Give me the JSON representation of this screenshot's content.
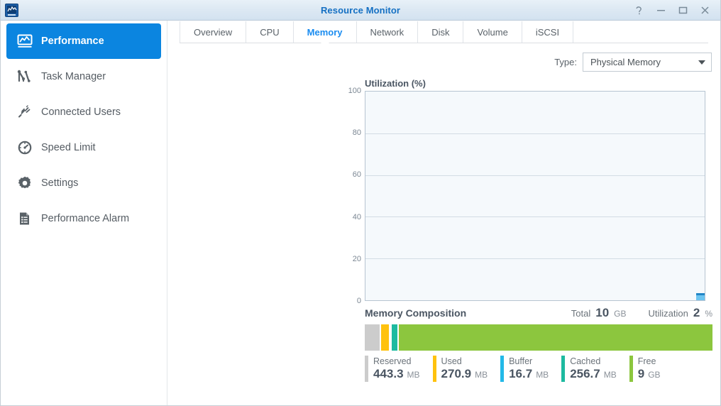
{
  "window": {
    "title": "Resource Monitor",
    "app_icon": "resource-monitor-icon",
    "buttons": [
      {
        "name": "help-button",
        "glyph": "?"
      },
      {
        "name": "minimize-button",
        "glyph": "–"
      },
      {
        "name": "maximize-button",
        "glyph": "☐"
      },
      {
        "name": "close-button",
        "glyph": "✕"
      }
    ]
  },
  "sidebar": {
    "items": [
      {
        "label": "Performance",
        "icon": "performance-chart-icon",
        "active": true
      },
      {
        "label": "Task Manager",
        "icon": "task-manager-icon",
        "active": false
      },
      {
        "label": "Connected Users",
        "icon": "plug-icon",
        "active": false
      },
      {
        "label": "Speed Limit",
        "icon": "speedometer-icon",
        "active": false
      },
      {
        "label": "Settings",
        "icon": "gear-icon",
        "active": false
      },
      {
        "label": "Performance Alarm",
        "icon": "document-list-icon",
        "active": false
      }
    ]
  },
  "tabs": [
    {
      "label": "Overview",
      "active": false
    },
    {
      "label": "CPU",
      "active": false
    },
    {
      "label": "Memory",
      "active": true
    },
    {
      "label": "Network",
      "active": false
    },
    {
      "label": "Disk",
      "active": false
    },
    {
      "label": "Volume",
      "active": false
    },
    {
      "label": "iSCSI",
      "active": false
    }
  ],
  "type_selector": {
    "label": "Type:",
    "value": "Physical Memory",
    "caret_icon": "chevron-down-icon"
  },
  "memory_composition": {
    "title": "Memory Composition",
    "total_key": "Total",
    "total_value": "10",
    "total_unit": "GB",
    "utilization_key": "Utilization",
    "utilization_value": "2",
    "utilization_unit": "%",
    "segments": [
      {
        "label": "Reserved",
        "value": "443.3",
        "unit": "MB",
        "color": "#cccccc",
        "pct": 4.6
      },
      {
        "label": "Used",
        "value": "270.9",
        "unit": "MB",
        "color": "#ffc20e",
        "pct": 2.7
      },
      {
        "label": "Buffer",
        "value": "16.7",
        "unit": "MB",
        "color": "#23b9e8",
        "pct": 0.55
      },
      {
        "label": "Cached",
        "value": "256.7",
        "unit": "MB",
        "color": "#1dbaa0",
        "pct": 2.0
      },
      {
        "label": "Free",
        "value": "9",
        "unit": "GB",
        "color": "#8cc63e",
        "pct": 90.15
      }
    ]
  },
  "chart_data": {
    "type": "area",
    "title": "Utilization (%)",
    "xlabel": "",
    "ylabel": "Utilization (%)",
    "ylim": [
      0,
      100
    ],
    "yticks": [
      100,
      80,
      60,
      40,
      20,
      0
    ],
    "grid": true,
    "legend": "none",
    "series": [
      {
        "name": "Memory Utilization",
        "color": "#6cc4f0",
        "values": [
          2
        ]
      }
    ],
    "note": "Chart is nearly empty; a single 2% data marker is drawn at the right edge of the plot."
  }
}
